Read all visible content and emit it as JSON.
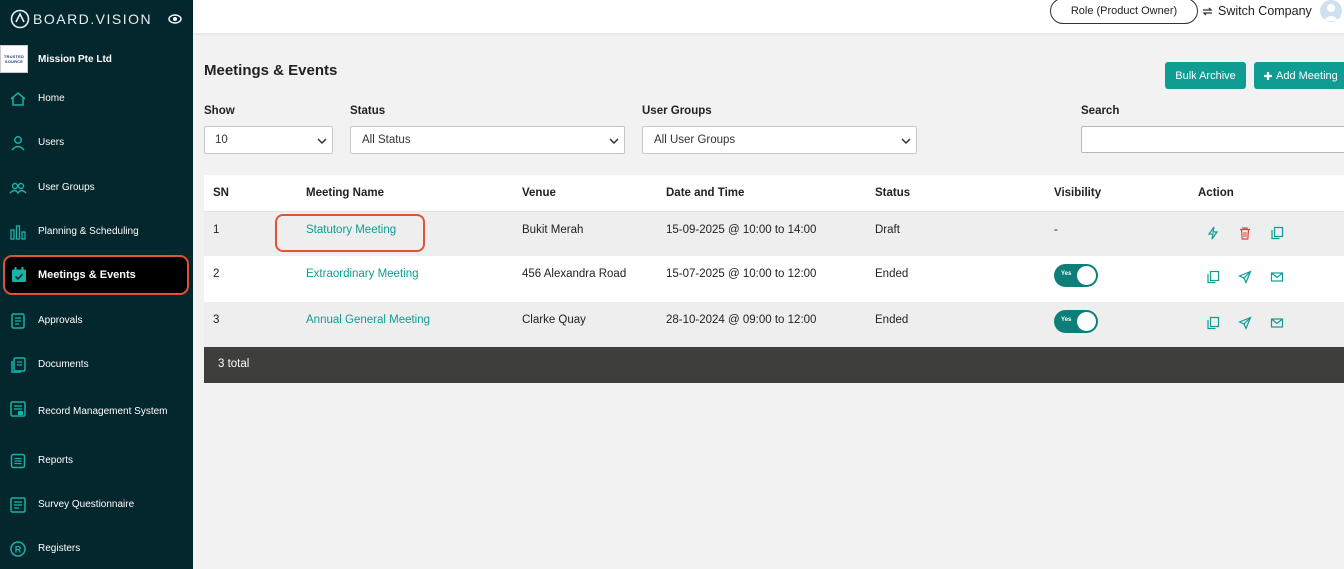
{
  "app": {
    "brand": "BOARD.VISION",
    "company_name": "Mission Pte Ltd",
    "company_logo_text": [
      "TRUSTED",
      "SOURCE"
    ],
    "accent_color": "#0f9c93",
    "sidebar_color": "#04262d",
    "highlight_color": "#e0523a"
  },
  "sidebar": {
    "items": [
      {
        "label": "Home",
        "icon": "home-icon"
      },
      {
        "label": "Users",
        "icon": "user-icon"
      },
      {
        "label": "User Groups",
        "icon": "user-groups-icon"
      },
      {
        "label": "Planning & Scheduling",
        "icon": "bar-chart-icon"
      },
      {
        "label": "Meetings & Events",
        "icon": "calendar-check-icon",
        "active": true
      },
      {
        "label": "Approvals",
        "icon": "approvals-icon"
      },
      {
        "label": "Documents",
        "icon": "documents-icon"
      },
      {
        "label": "Record Management System",
        "icon": "record-icon"
      },
      {
        "label": "Reports",
        "icon": "reports-icon"
      },
      {
        "label": "Survey Questionnaire",
        "icon": "survey-icon"
      },
      {
        "label": "Registers",
        "icon": "registered-icon"
      }
    ]
  },
  "topbar": {
    "role": "Role (Product Owner)",
    "switch_company": "Switch Company"
  },
  "page": {
    "title": "Meetings & Events",
    "bulk_archive": "Bulk Archive",
    "add_meeting": "Add Meeting"
  },
  "filters": {
    "show_label": "Show",
    "show_value": "10",
    "status_label": "Status",
    "status_value": "All Status",
    "groups_label": "User Groups",
    "groups_value": "All User Groups",
    "search_label": "Search",
    "search_value": ""
  },
  "table": {
    "headers": [
      "SN",
      "Meeting Name",
      "Venue",
      "Date and Time",
      "Status",
      "Visibility",
      "Action"
    ],
    "rows": [
      {
        "sn": "1",
        "name": "Statutory Meeting",
        "venue": "Bukit Merah",
        "datetime": "15-09-2025 @ 10:00 to 14:00",
        "status": "Draft",
        "visibility": "-",
        "actions": [
          "lightning-icon",
          "trash-icon",
          "copy-icon"
        ]
      },
      {
        "sn": "2",
        "name": "Extraordinary Meeting",
        "venue": "456 Alexandra Road",
        "datetime": "15-07-2025 @ 10:00 to 12:00",
        "status": "Ended",
        "visibility": "Yes",
        "actions": [
          "copy-icon",
          "send-icon",
          "mail-icon"
        ]
      },
      {
        "sn": "3",
        "name": "Annual General Meeting",
        "venue": "Clarke Quay",
        "datetime": "28-10-2024 @ 09:00 to 12:00",
        "status": "Ended",
        "visibility": "Yes",
        "actions": [
          "copy-icon",
          "send-icon",
          "mail-icon"
        ]
      }
    ],
    "total": "3 total"
  }
}
